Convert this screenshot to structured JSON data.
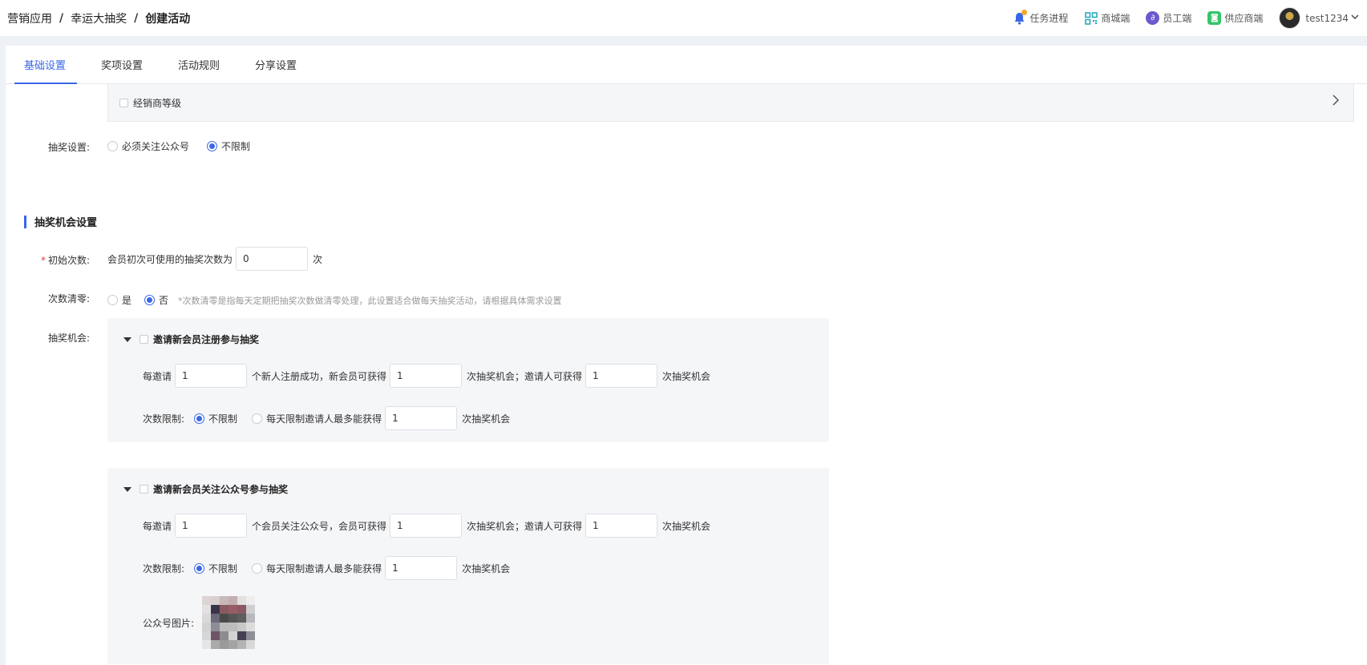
{
  "breadcrumb": [
    "营销应用",
    "幸运大抽奖",
    "创建活动"
  ],
  "breadcrumb_sep": "/",
  "header": {
    "links": [
      {
        "label": "任务进程",
        "icon": "bell-icon"
      },
      {
        "label": "商城端",
        "icon": "qrcode-icon"
      },
      {
        "label": "员工端",
        "icon": "link-icon"
      },
      {
        "label": "供应商端",
        "icon": "wechat-icon"
      }
    ],
    "user": "test1234"
  },
  "tabs": [
    "基础设置",
    "奖项设置",
    "活动规则",
    "分享设置"
  ],
  "active_tab": "基础设置",
  "dealer_level": {
    "label": "经销商等级"
  },
  "draw_setting": {
    "label": "抽奖设置:",
    "options": [
      "必须关注公众号",
      "不限制"
    ],
    "selected": "不限制"
  },
  "section_title": "抽奖机会设置",
  "initial_count": {
    "label": "初始次数:",
    "prefix": "会员初次可使用的抽奖次数为",
    "value": "0",
    "suffix": "次"
  },
  "reset_count": {
    "label": "次数清零:",
    "options": [
      "是",
      "否"
    ],
    "selected": "否",
    "hint": "*次数清零是指每天定期把抽奖次数做清零处理，此设置适合做每天抽奖活动，请根据具体需求设置"
  },
  "chance_label": "抽奖机会:",
  "cards": [
    {
      "title": "邀请新会员注册参与抽奖",
      "invite_prefix": "每邀请",
      "invite_value": "1",
      "invite_mid": "个新人注册成功，新会员可获得",
      "member_value": "1",
      "member_suffix": "次抽奖机会；邀请人可获得",
      "inviter_value": "1",
      "inviter_suffix": "次抽奖机会",
      "limit_label": "次数限制:",
      "limit_options": [
        "不限制",
        "每天限制邀请人最多能获得"
      ],
      "limit_selected": "不限制",
      "limit_value": "1",
      "limit_suffix": "次抽奖机会"
    },
    {
      "title": "邀请新会员关注公众号参与抽奖",
      "invite_prefix": "每邀请",
      "invite_value": "1",
      "invite_mid": "个会员关注公众号，会员可获得",
      "member_value": "1",
      "member_suffix": "次抽奖机会；邀请人可获得",
      "inviter_value": "1",
      "inviter_suffix": "次抽奖机会",
      "limit_label": "次数限制:",
      "limit_options": [
        "不限制",
        "每天限制邀请人最多能获得"
      ],
      "limit_selected": "不限制",
      "limit_value": "1",
      "limit_suffix": "次抽奖机会",
      "image_label": "公众号图片:"
    }
  ],
  "colors": {
    "accent": "#3a67e8",
    "required": "#e4393c",
    "card_bg": "#f5f6f8"
  }
}
